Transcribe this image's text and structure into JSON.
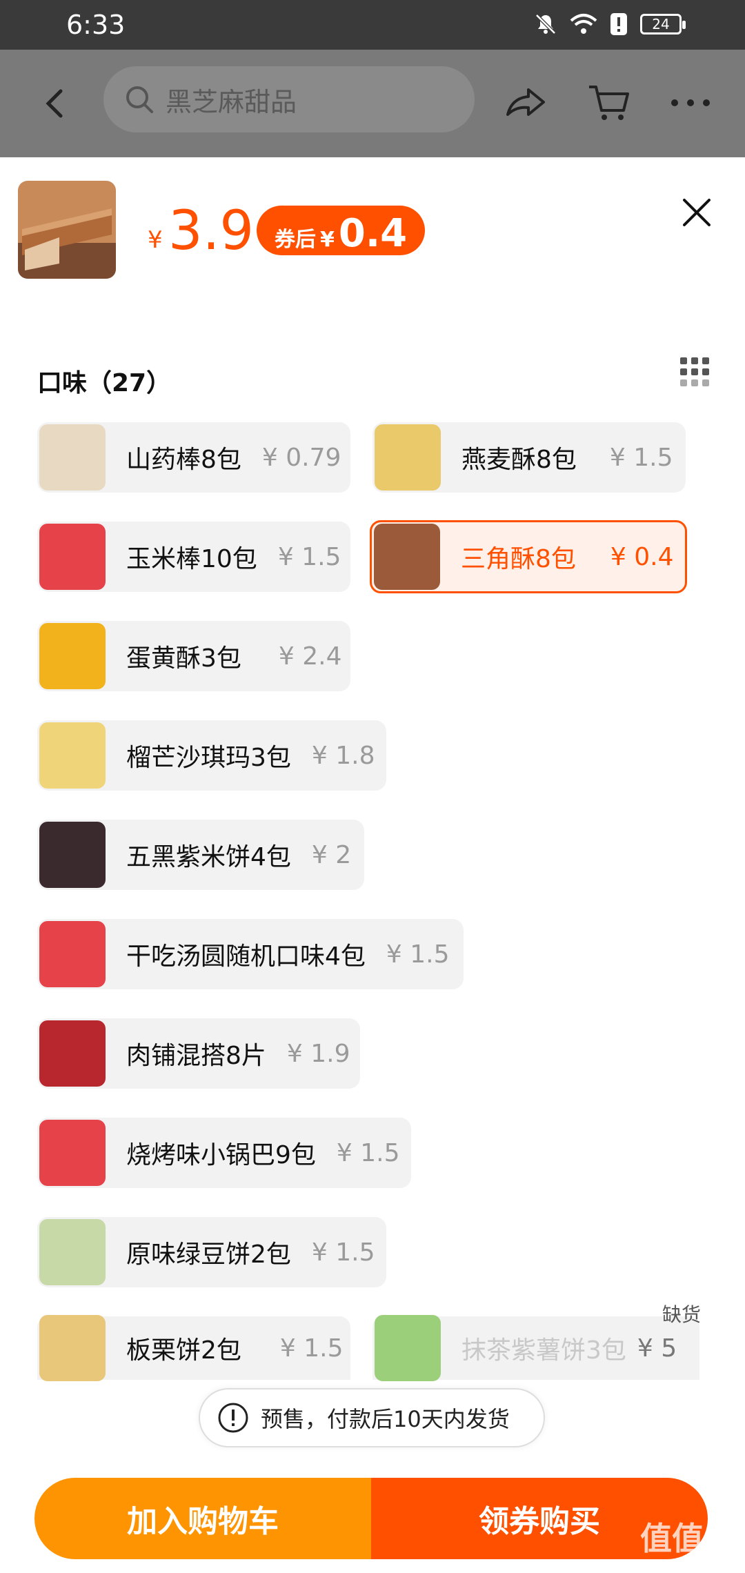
{
  "status": {
    "time": "6:33",
    "battery": "24"
  },
  "nav": {
    "search_placeholder": "黑芝麻甜品"
  },
  "product": {
    "price_symbol": "¥",
    "price": "3.9",
    "coupon_label": "券后",
    "coupon_symbol": "¥",
    "coupon_price": "0.4"
  },
  "section": {
    "title": "口味（27）"
  },
  "options": [
    {
      "name": "山药棒8包",
      "price": "¥ 0.79",
      "thumb": "#e8d9c2"
    },
    {
      "name": "燕麦酥8包",
      "price": "¥ 1.5",
      "thumb": "#e9c96a"
    },
    {
      "name": "玉米棒10包",
      "price": "¥ 1.5",
      "thumb": "#e6424a"
    },
    {
      "name": "三角酥8包",
      "price": "¥ 0.4",
      "thumb": "#9b5a3a",
      "selected": true
    },
    {
      "name": "蛋黄酥3包",
      "price": "¥ 2.4",
      "thumb": "#f2b21c"
    },
    {
      "name": "榴芒沙琪玛3包",
      "price": "¥ 1.8",
      "thumb": "#f0d47a"
    },
    {
      "name": "五黑紫米饼4包",
      "price": "¥ 2",
      "thumb": "#3a2a2e"
    },
    {
      "name": "干吃汤圆随机口味4包",
      "price": "¥ 1.5",
      "thumb": "#e6424a"
    },
    {
      "name": "肉铺混搭8片",
      "price": "¥ 1.9",
      "thumb": "#b8262e"
    },
    {
      "name": "烧烤味小锅巴9包",
      "price": "¥ 1.5",
      "thumb": "#e6424a"
    },
    {
      "name": "原味绿豆饼2包",
      "price": "¥ 1.5",
      "thumb": "#c7d9a6"
    },
    {
      "name": "板栗饼2包",
      "price": "¥ 1.5",
      "thumb": "#e8c67a"
    },
    {
      "name": "抹茶紫薯饼3包",
      "price": "¥ 5",
      "thumb": "#9ccf7a",
      "disabled": true
    }
  ],
  "out_of_stock": "缺货",
  "presale": {
    "text": "预售，付款后10天内发货"
  },
  "buttons": {
    "add_cart": "加入购物车",
    "buy": "领券购买"
  },
  "watermark": "值值值"
}
